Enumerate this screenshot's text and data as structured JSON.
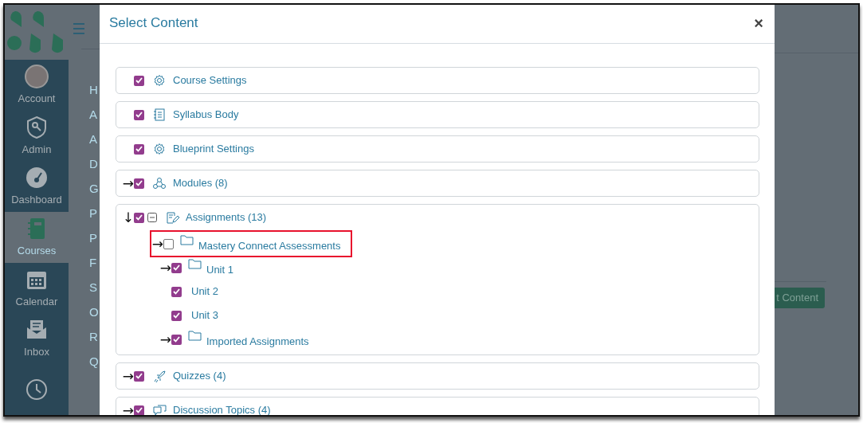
{
  "sidebar": {
    "nav_items": [
      {
        "label": "Account",
        "kind": "avatar",
        "selected": false
      },
      {
        "label": "Admin",
        "kind": "shield",
        "selected": false
      },
      {
        "label": "Dashboard",
        "kind": "gauge",
        "selected": false
      },
      {
        "label": "Courses",
        "kind": "book",
        "selected": true
      },
      {
        "label": "Calendar",
        "kind": "calendar",
        "selected": false
      },
      {
        "label": "Inbox",
        "kind": "inbox",
        "selected": false
      },
      {
        "kind": "clock",
        "selected": false
      }
    ]
  },
  "course_nav": [
    "H",
    "A",
    "A",
    "D",
    "G",
    "P",
    "P",
    "F",
    "S",
    "O",
    "R",
    "Q"
  ],
  "background_button": "t Content",
  "modal": {
    "title": "Select Content",
    "close": "×",
    "items": [
      {
        "label": "Course Settings",
        "kind": "gear",
        "checked": true
      },
      {
        "label": "Syllabus Body",
        "kind": "syllabus",
        "checked": true
      },
      {
        "label": "Blueprint Settings",
        "kind": "gear",
        "checked": true
      },
      {
        "label": "Modules (8)",
        "kind": "modules",
        "checked": true,
        "arrow": "→"
      },
      {
        "label": "Assignments (13)",
        "kind": "assignment",
        "checked": true,
        "arrow": "↓",
        "expanded": true,
        "children": [
          {
            "label": "Mastery Connect Assessments",
            "kind": "folder",
            "checked": false,
            "arrow": "→",
            "highlighted": true
          },
          {
            "label": "Unit 1",
            "kind": "folder",
            "checked": true,
            "arrow": "→",
            "highlighted": false
          },
          {
            "label": "Unit 2",
            "kind": "page",
            "checked": true,
            "highlighted": false
          },
          {
            "label": "Unit 3",
            "kind": "page",
            "checked": true,
            "highlighted": false
          },
          {
            "label": "Imported Assignments",
            "kind": "folder",
            "checked": true,
            "arrow": "→",
            "highlighted": false
          }
        ]
      },
      {
        "label": "Quizzes (4)",
        "kind": "rocket",
        "checked": true,
        "arrow": "→"
      },
      {
        "label": "Discussion Topics (4)",
        "kind": "discussion",
        "checked": true,
        "arrow": "→"
      }
    ]
  }
}
